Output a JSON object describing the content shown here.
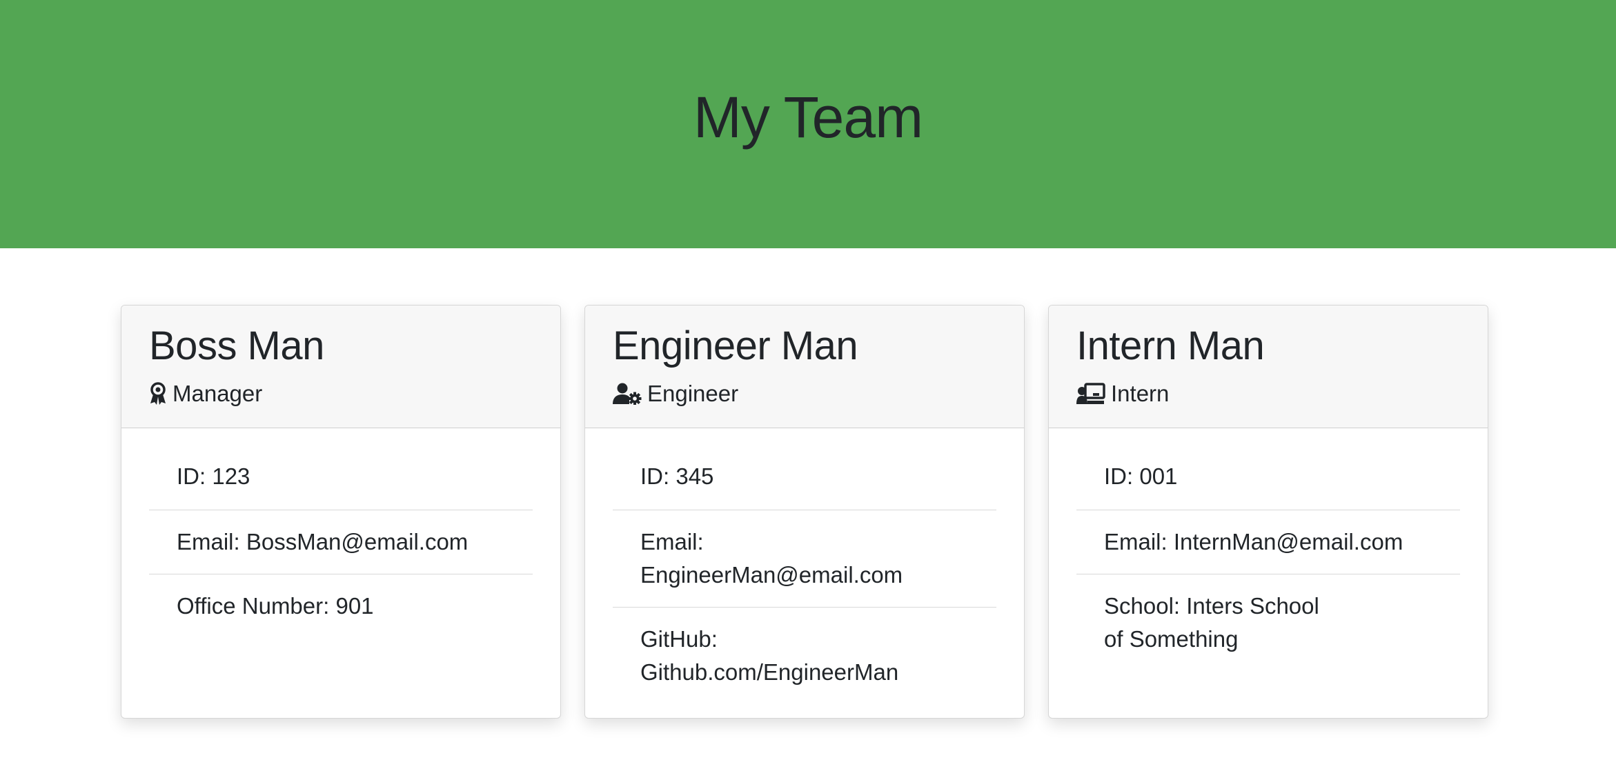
{
  "header": {
    "title": "My Team"
  },
  "team": [
    {
      "name": "Boss Man",
      "role": "Manager",
      "role_icon": "award-ribbon-icon",
      "items": [
        "ID: 123",
        "Email: BossMan@email.com",
        "Office Number: 901"
      ]
    },
    {
      "name": "Engineer Man",
      "role": "Engineer",
      "role_icon": "user-gear-icon",
      "items": [
        "ID: 345",
        "Email: EngineerMan@email.com",
        "GitHub: Github.com/EngineerMan"
      ]
    },
    {
      "name": "Intern Man",
      "role": "Intern",
      "role_icon": "user-chalkboard-icon",
      "items": [
        "ID: 001",
        "Email: InternMan@email.com",
        "School: Inters School of Something"
      ]
    }
  ],
  "colors": {
    "header_bg": "#53a653",
    "card_header_bg": "#f7f7f7",
    "text": "#212529"
  }
}
